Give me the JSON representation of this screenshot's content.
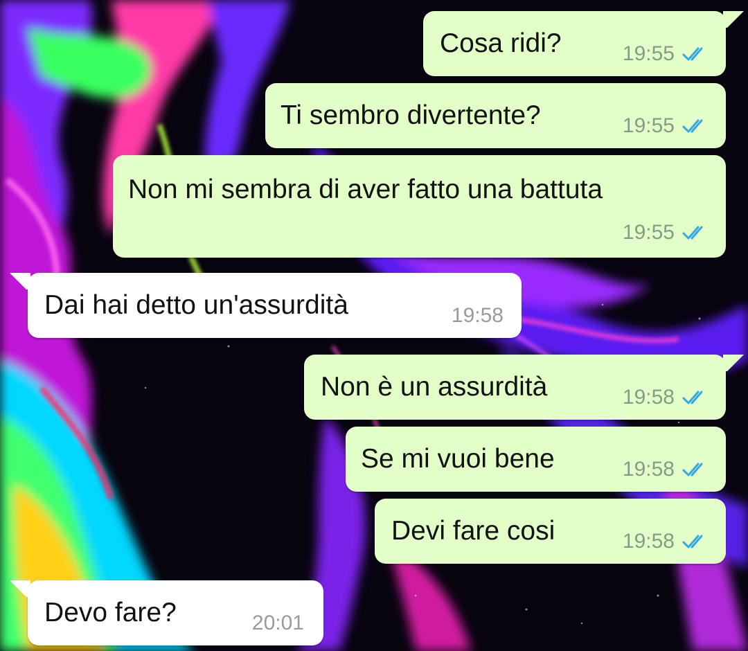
{
  "chat": {
    "messages": [
      {
        "direction": "out",
        "text": "Cosa ridi?",
        "time": "19:55",
        "status": "read",
        "status_icon": "double-check-icon"
      },
      {
        "direction": "out",
        "text": "Ti sembro divertente?",
        "time": "19:55",
        "status": "read",
        "status_icon": "double-check-icon"
      },
      {
        "direction": "out",
        "text": "Non mi sembra di aver fatto una battuta",
        "time": "19:55",
        "status": "read",
        "status_icon": "double-check-icon"
      },
      {
        "direction": "in",
        "text": "Dai hai detto un'assurdità",
        "time": "19:58"
      },
      {
        "direction": "out",
        "text": "Non è un assurdità",
        "time": "19:58",
        "status": "read",
        "status_icon": "double-check-icon"
      },
      {
        "direction": "out",
        "text": "Se mi vuoi bene",
        "time": "19:58",
        "status": "read",
        "status_icon": "double-check-icon"
      },
      {
        "direction": "out",
        "text": "Devi fare cosi",
        "time": "19:58",
        "status": "read",
        "status_icon": "double-check-icon"
      },
      {
        "direction": "in",
        "text": "Devo fare?",
        "time": "20:01"
      }
    ]
  },
  "colors": {
    "outgoing_bubble": "#e2ffc8",
    "incoming_bubble": "#ffffff",
    "read_ticks": "#34a8e8",
    "wallpaper_base": "#07040f"
  },
  "wallpaper": {
    "style": "psychedelic-liquid-swirl"
  }
}
